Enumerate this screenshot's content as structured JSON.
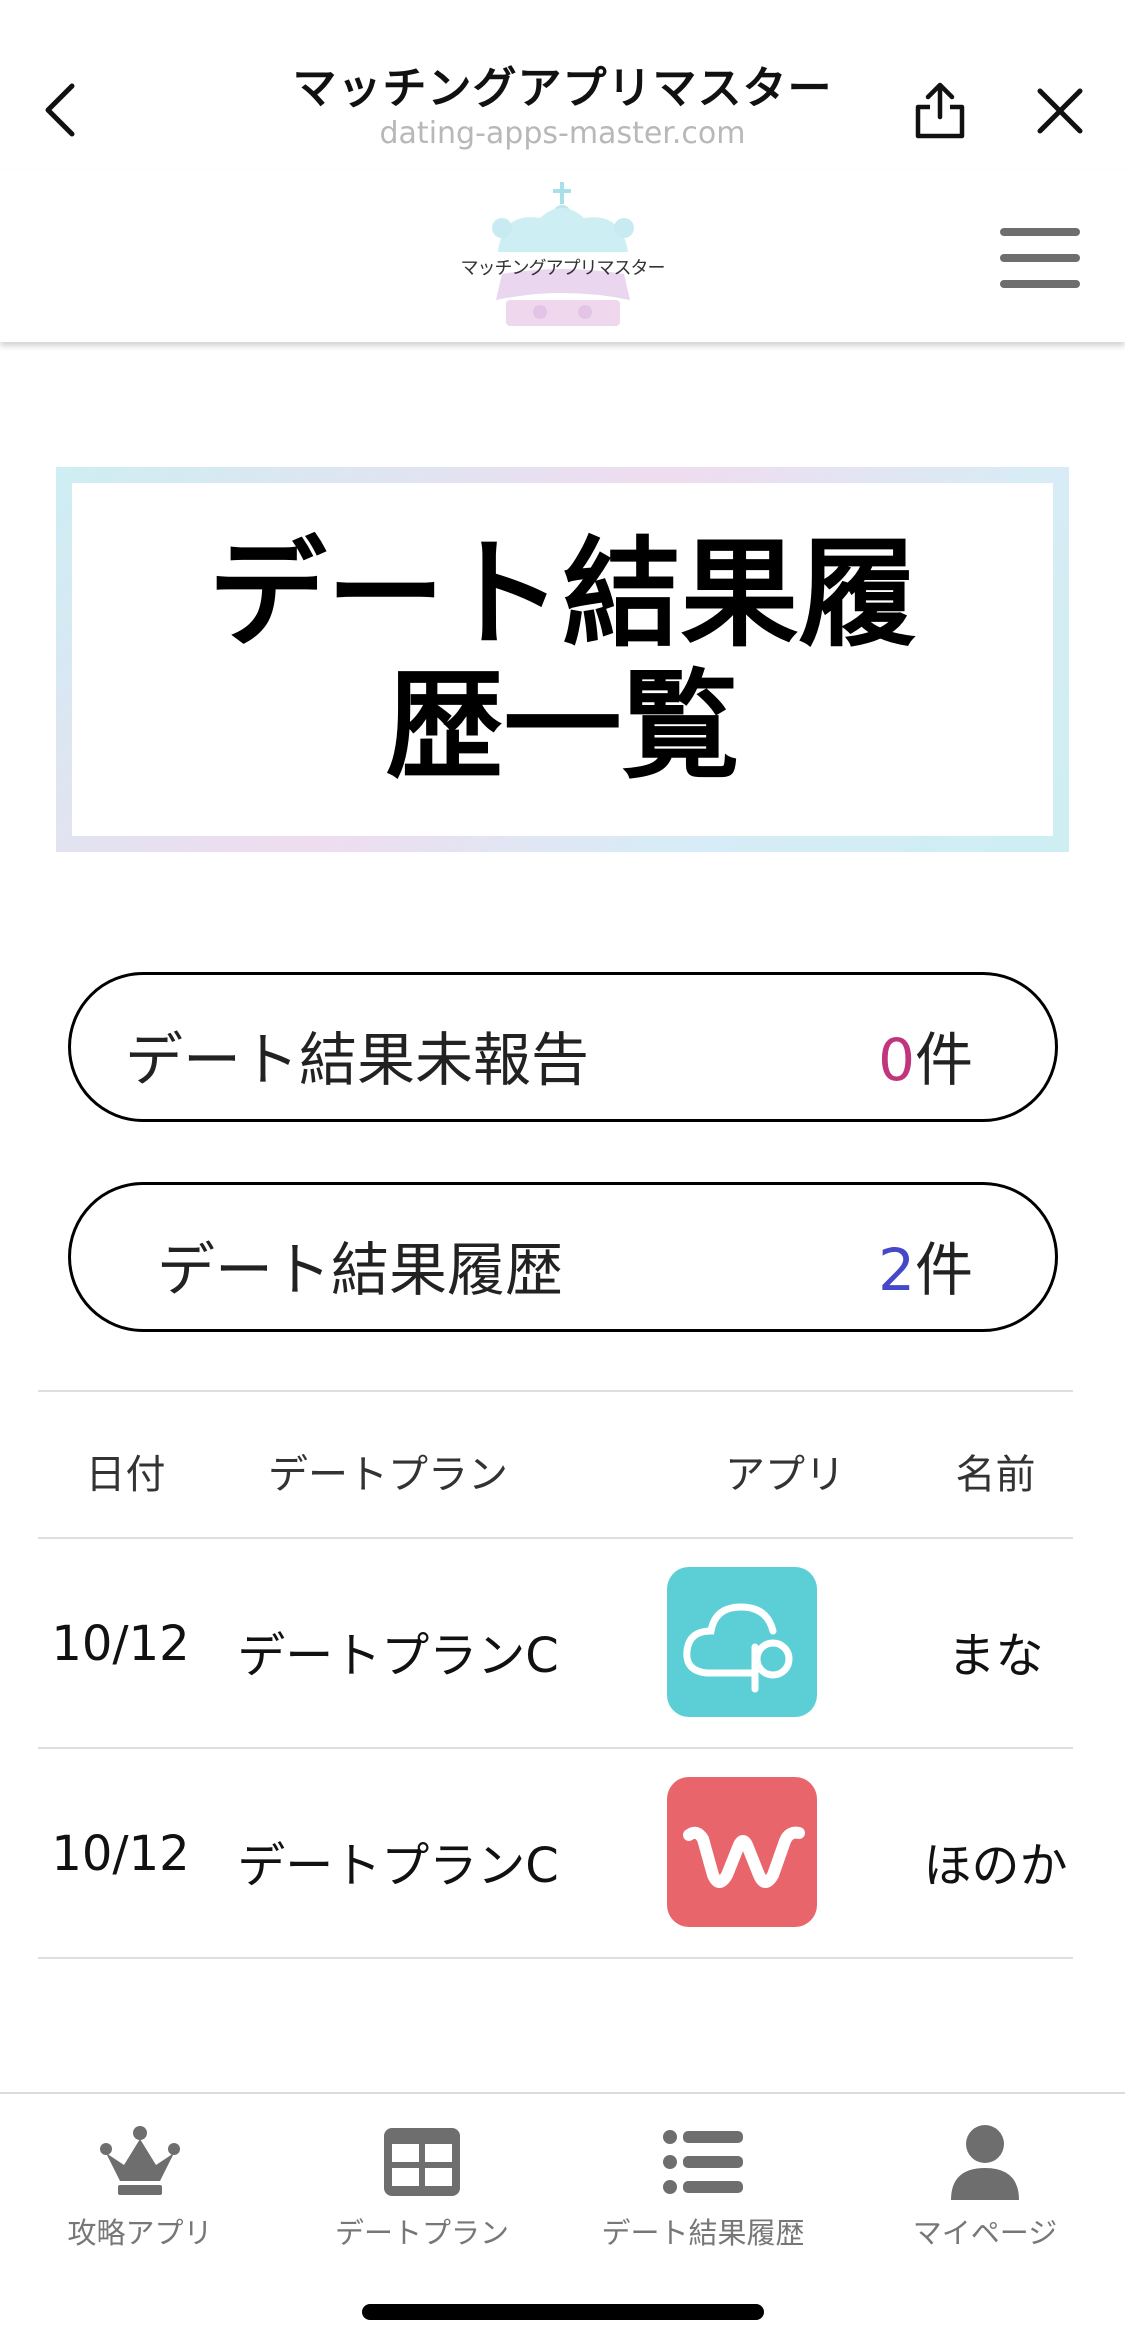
{
  "browser": {
    "title": "マッチングアプリマスター",
    "url": "dating-apps-master.com"
  },
  "header": {
    "logo_text": "マッチングアプリマスター"
  },
  "page": {
    "title": "デート結果履歴一覧"
  },
  "summary": {
    "unreported": {
      "label": "デート結果未報告",
      "count": "0",
      "unit": "件"
    },
    "history": {
      "label": "デート結果履歴",
      "count": "2",
      "unit": "件"
    }
  },
  "table": {
    "headers": [
      "日付",
      "デートプラン",
      "アプリ",
      "名前"
    ],
    "rows": [
      {
        "date": "10/12",
        "plan": "デートプランC",
        "app_icon": "pairs-cloud-p-icon",
        "name": "まな"
      },
      {
        "date": "10/12",
        "plan": "デートプランC",
        "app_icon": "with-w-icon",
        "name": "ほのか"
      }
    ]
  },
  "tabbar": {
    "items": [
      {
        "label": "攻略アプリ",
        "icon": "crown-icon"
      },
      {
        "label": "デートプラン",
        "icon": "grid-icon"
      },
      {
        "label": "デート結果履歴",
        "icon": "list-icon"
      },
      {
        "label": "マイページ",
        "icon": "person-icon"
      }
    ]
  },
  "colors": {
    "count_zero": "#c0357d",
    "count_history": "#4548c8",
    "pairs_icon": "#5ccfd6",
    "with_icon": "#e8666b",
    "tab_icon": "#6e6e6e"
  }
}
